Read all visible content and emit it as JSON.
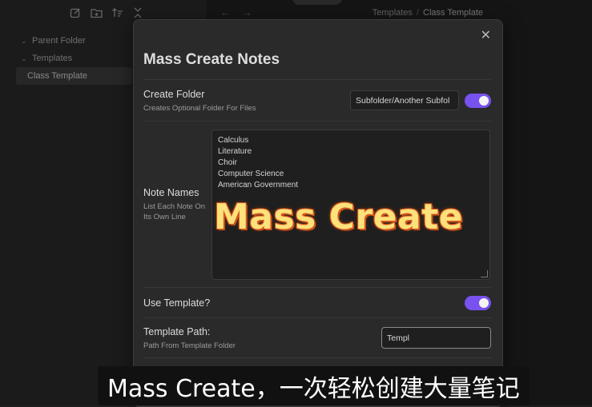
{
  "sidebar": {
    "toolbar_icons": [
      "new-note-icon",
      "new-folder-icon",
      "sort-icon",
      "collapse-icon"
    ],
    "tree": [
      {
        "label": "Parent Folder",
        "expanded": false
      },
      {
        "label": "Templates",
        "expanded": true
      },
      {
        "label": "Class Template",
        "selected": true
      }
    ]
  },
  "topbar": {
    "breadcrumb_root": "Templates",
    "breadcrumb_sep": "/",
    "breadcrumb_current": "Class Template"
  },
  "modal": {
    "title": "Mass Create Notes",
    "close_glyph": "✕",
    "create_folder": {
      "name": "Create Folder",
      "desc": "Creates Optional Folder For Files",
      "value": "Subfolder/Another Subfol",
      "toggle_on": true
    },
    "note_names": {
      "name": "Note Names",
      "desc": "List Each Note On Its Own Line",
      "lines": [
        "Calculus",
        "Literature",
        "Choir",
        "Computer Science",
        "American Government"
      ]
    },
    "use_template": {
      "name": "Use Template?",
      "toggle_on": true
    },
    "template_path": {
      "name": "Template Path:",
      "desc": "Path From Template Folder",
      "value": "Templ"
    }
  },
  "overlay_caption": "Mass Create",
  "subtitle": "Mass Create，一次轻松创建大量笔记",
  "colors": {
    "accent": "#7852ee",
    "caption_fill": "#fde17a",
    "caption_outline": "#d2541c"
  }
}
